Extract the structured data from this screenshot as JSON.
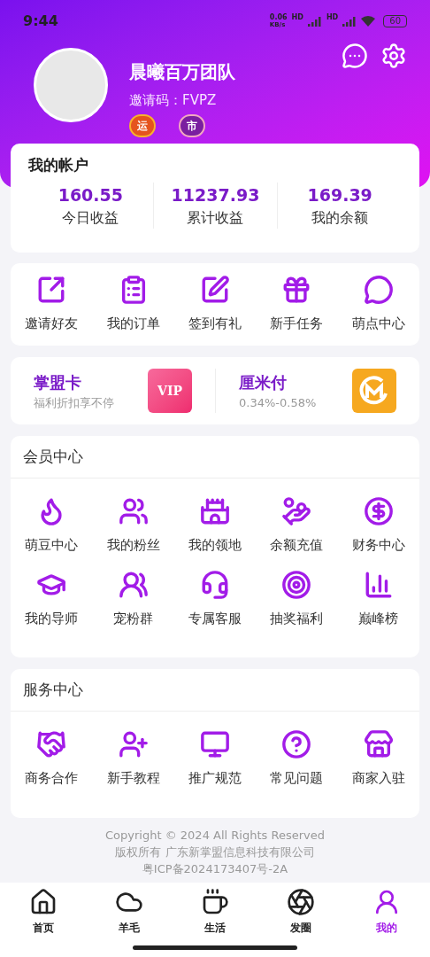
{
  "status_bar": {
    "time": "9:44",
    "speed": "0.06",
    "speed_unit": "KB/s",
    "network_1": "HD",
    "network_2": "HD",
    "battery": "60"
  },
  "profile": {
    "name": "晨曦百万团队",
    "invite_code": "邀请码：FVPZ",
    "badges": [
      "运",
      "市"
    ]
  },
  "account": {
    "title": "我的帐户",
    "stats": [
      {
        "value": "160.55",
        "label": "今日收益"
      },
      {
        "value": "11237.93",
        "label": "累计收益"
      },
      {
        "value": "169.39",
        "label": "我的余额"
      }
    ]
  },
  "quick_actions": [
    "邀请好友",
    "我的订单",
    "签到有礼",
    "新手任务",
    "萌点中心"
  ],
  "promo_cards": [
    {
      "kind": "vip",
      "title": "掌盟卡",
      "subtitle": "福利折扣享不停",
      "badge": "VIP"
    },
    {
      "kind": "pay",
      "title": "厘米付",
      "subtitle": "0.34%-0.58%"
    }
  ],
  "member_center": {
    "title": "会员中心",
    "items": [
      "萌豆中心",
      "我的粉丝",
      "我的领地",
      "余额充值",
      "财务中心",
      "我的导师",
      "宠粉群",
      "专属客服",
      "抽奖福利",
      "巅峰榜"
    ]
  },
  "service_center": {
    "title": "服务中心",
    "items": [
      "商务合作",
      "新手教程",
      "推广规范",
      "常见问题",
      "商家入驻"
    ]
  },
  "footer": [
    "Copyright © 2024 All Rights Reserved",
    "版权所有 广东新掌盟信息科技有限公司",
    "粤ICP备2024173407号-2A"
  ],
  "tab_bar": [
    {
      "label": "首页",
      "selected": false
    },
    {
      "label": "羊毛",
      "selected": false
    },
    {
      "label": "生活",
      "selected": false
    },
    {
      "label": "发圈",
      "selected": false
    },
    {
      "label": "我的",
      "selected": true
    }
  ]
}
